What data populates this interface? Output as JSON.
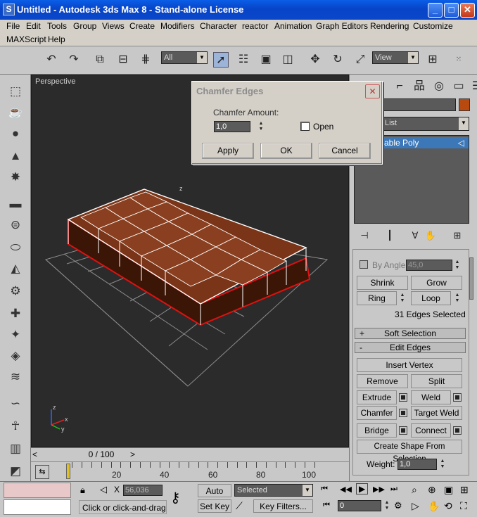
{
  "window": {
    "title": "Untitled - Autodesk 3ds Max 8  - Stand-alone License",
    "app_icon": "S",
    "minimize_icon": "minimize-icon",
    "maximize_icon": "maximize-icon",
    "close_icon": "close-icon"
  },
  "menu": {
    "items": [
      "File",
      "Edit",
      "Tools",
      "Group",
      "Views",
      "Create",
      "Modifiers",
      "Character",
      "reactor",
      "Animation",
      "Graph Editors",
      "Rendering",
      "Customize",
      "MAXScript",
      "Help"
    ]
  },
  "toolbar": {
    "selection_filter": "All",
    "ref_coord": "View"
  },
  "viewport": {
    "label": "Perspective",
    "axis_labels": {
      "x": "x",
      "y": "y",
      "z": "z"
    },
    "colors": {
      "bg": "#2b2b2b",
      "grid": "#8c8c8c",
      "object": "#4a1e0a",
      "object_top": "#7a3418",
      "edges": "#ffffff",
      "selected": "#e01010"
    }
  },
  "dialog": {
    "title": "Chamfer Edges",
    "amount_label": "Chamfer Amount:",
    "amount_value": "1,0",
    "open_label": "Open",
    "open_checked": false,
    "apply": "Apply",
    "ok": "OK",
    "cancel": "Cancel"
  },
  "command_panel": {
    "modifier_list": "List",
    "stack_item": "able Poly",
    "by_angle_label": "By Angle:",
    "by_angle_value": "45,0",
    "shrink": "Shrink",
    "grow": "Grow",
    "ring": "Ring",
    "loop": "Loop",
    "selection_status": "31 Edges Selected",
    "soft_selection": "Soft Selection",
    "edit_edges": "Edit Edges",
    "insert_vertex": "Insert Vertex",
    "remove": "Remove",
    "split": "Split",
    "extrude": "Extrude",
    "weld": "Weld",
    "chamfer": "Chamfer",
    "target_weld": "Target Weld",
    "bridge": "Bridge",
    "connect": "Connect",
    "create_shape": "Create Shape From Selection",
    "weight_label": "Weight:",
    "weight_value": "1,0",
    "color_swatch": "#b84a10"
  },
  "timeline": {
    "frame_display": "0 / 100",
    "ticks": [
      "20",
      "40",
      "60",
      "80",
      "100"
    ]
  },
  "status": {
    "coord_value": "56,036",
    "auto_key": "Auto Key",
    "set_key": "Set Key",
    "key_mode": "Selected",
    "key_filters": "Key Filters...",
    "frame_value": "0",
    "prompt": "Click or click-and-drag to"
  }
}
